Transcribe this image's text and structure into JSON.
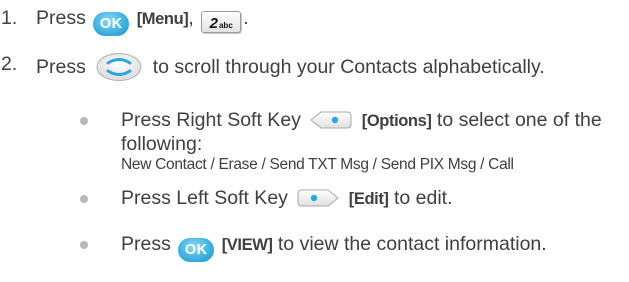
{
  "steps": [
    {
      "number": "1.",
      "prefix": "Press",
      "ok_key": "OK",
      "menu_label": "[Menu]",
      "separator": ",",
      "num_key_digit": "2",
      "num_key_letters": "abc",
      "suffix": "."
    },
    {
      "number": "2.",
      "prefix": "Press",
      "suffix": "to scroll through your Contacts alphabetically."
    }
  ],
  "bullets": [
    {
      "prefix": "Press Right Soft Key",
      "key_label": "[Options]",
      "suffix": "to select one of the",
      "line2": "following:",
      "options": "New Contact / Erase / Send TXT Msg / Send PIX Msg / Call"
    },
    {
      "prefix": "Press Left Soft Key",
      "key_label": "[Edit]",
      "suffix": "to edit."
    },
    {
      "prefix": "Press",
      "ok_key": "OK",
      "key_label": "[VIEW]",
      "suffix": "to view the contact information."
    }
  ],
  "colors": {
    "text": "#404040",
    "ok_key": "#3fb2e3",
    "bullet": "#b8b8b8"
  },
  "icons": {
    "ok_key": "ok-key-icon",
    "num_key": "number-2-key-icon",
    "nav_key": "navigation-key-icon",
    "right_soft_key": "right-soft-key-icon",
    "left_soft_key": "left-soft-key-icon"
  }
}
